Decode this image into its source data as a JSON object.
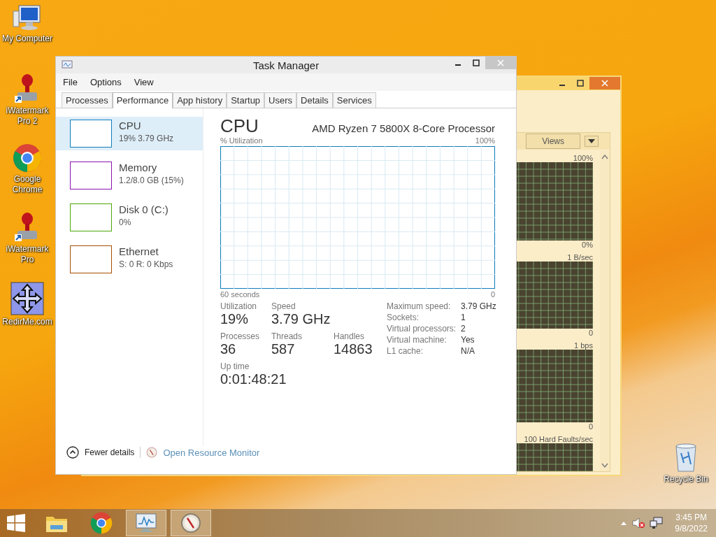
{
  "desktop_icons": [
    {
      "label": "My Computer",
      "kind": "computer"
    },
    {
      "label": "iWatermark Pro 2",
      "kind": "stamp"
    },
    {
      "label": "Google Chrome",
      "kind": "chrome"
    },
    {
      "label": "iWatermark Pro",
      "kind": "stamp"
    },
    {
      "label": "RedirMe.com",
      "kind": "arrows"
    }
  ],
  "recycle_bin": {
    "label": "Recycle Bin"
  },
  "task_manager": {
    "title": "Task Manager",
    "menu": [
      "File",
      "Options",
      "View"
    ],
    "tabs": [
      {
        "label": "Processes",
        "selected": false
      },
      {
        "label": "Performance",
        "selected": true
      },
      {
        "label": "App history",
        "selected": false
      },
      {
        "label": "Startup",
        "selected": false
      },
      {
        "label": "Users",
        "selected": false
      },
      {
        "label": "Details",
        "selected": false
      },
      {
        "label": "Services",
        "selected": false
      }
    ],
    "resources": [
      {
        "name": "CPU",
        "detail": "19% 3.79 GHz",
        "selected": true,
        "color": "#117dbb"
      },
      {
        "name": "Memory",
        "detail": "1.2/8.0 GB (15%)",
        "selected": false,
        "color": "#8b12ae"
      },
      {
        "name": "Disk 0 (C:)",
        "detail": "0%",
        "selected": false,
        "color": "#4da60c"
      },
      {
        "name": "Ethernet",
        "detail": "S: 0 R: 0 Kbps",
        "selected": false,
        "color": "#a74f01"
      }
    ],
    "detail": {
      "title": "CPU",
      "processor": "AMD Ryzen 7 5800X 8-Core Processor",
      "graph_label": "% Utilization",
      "graph_max": "100%",
      "graph_span": "60 seconds",
      "graph_min": "0",
      "stats": [
        {
          "label": "Utilization",
          "value": "19%"
        },
        {
          "label": "Speed",
          "value": "3.79 GHz"
        },
        {
          "label": "Processes",
          "value": "36"
        },
        {
          "label": "Threads",
          "value": "587"
        },
        {
          "label": "Handles",
          "value": "14863"
        },
        {
          "label": "Up time",
          "value": "0:01:48:21"
        }
      ],
      "specs": [
        {
          "label": "Maximum speed:",
          "value": "3.79 GHz"
        },
        {
          "label": "Sockets:",
          "value": "1"
        },
        {
          "label": "Virtual processors:",
          "value": "2"
        },
        {
          "label": "Virtual machine:",
          "value": "Yes"
        },
        {
          "label": "L1 cache:",
          "value": "N/A"
        }
      ]
    },
    "footer": {
      "fewer": "Fewer details",
      "link": "Open Resource Monitor"
    }
  },
  "resource_monitor": {
    "views": "Views",
    "graphs": [
      {
        "max": "100%",
        "min": "0%"
      },
      {
        "max": "1 B/sec",
        "min": "0"
      },
      {
        "max": "1 bps",
        "min": "0"
      },
      {
        "max": "100 Hard Faults/sec"
      }
    ]
  },
  "taskbar": {
    "apps": [
      {
        "kind": "explorer",
        "active": false
      },
      {
        "kind": "chrome",
        "active": false
      },
      {
        "kind": "taskmgr",
        "active": true
      },
      {
        "kind": "resmon",
        "active": true
      }
    ],
    "time": "3:45 PM",
    "date": "9/8/2022"
  }
}
